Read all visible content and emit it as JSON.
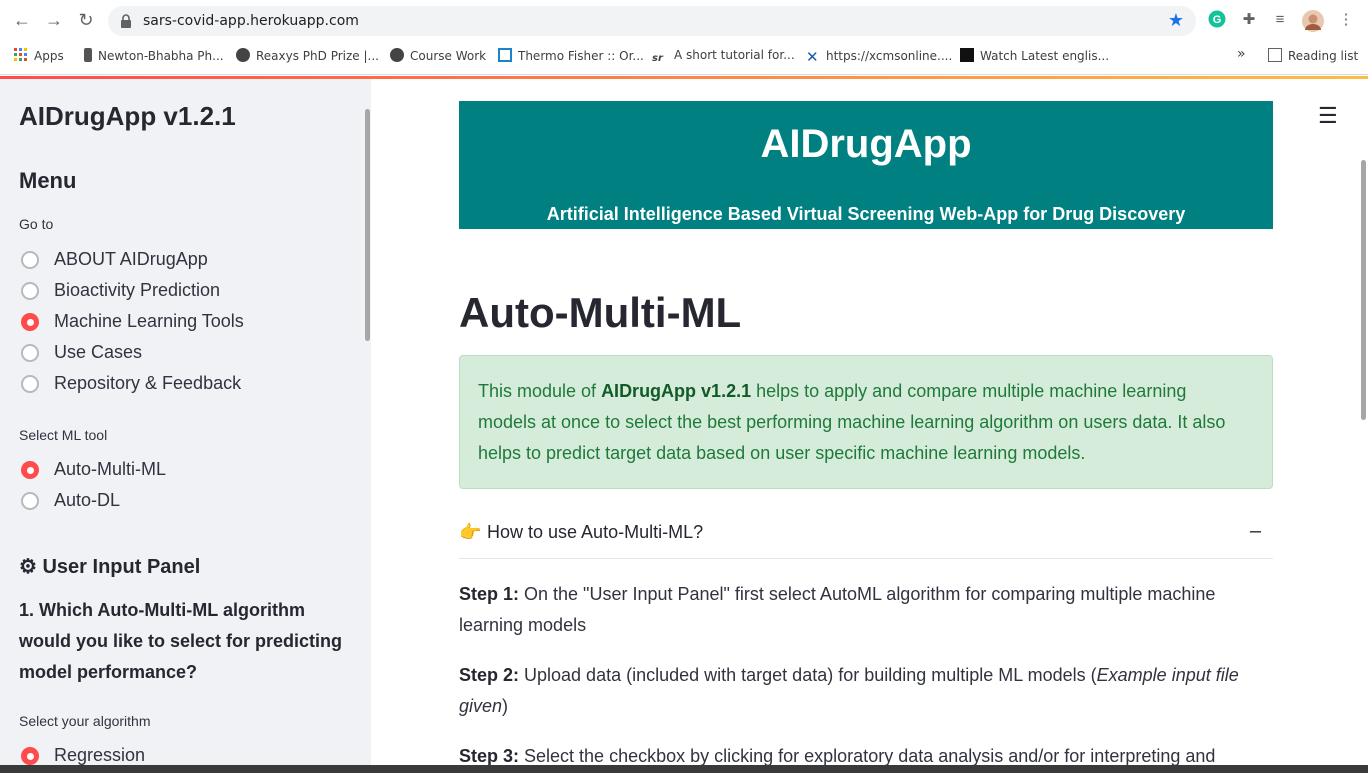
{
  "browser": {
    "url": "sars-covid-app.herokuapp.com",
    "bookmarks": [
      {
        "label": "Apps"
      },
      {
        "label": "Newton-Bhabha Ph..."
      },
      {
        "label": "Reaxys PhD Prize |..."
      },
      {
        "label": "Course Work"
      },
      {
        "label": "Thermo Fisher :: Or..."
      },
      {
        "label": "A short tutorial for..."
      },
      {
        "label": "https://xcmsonline...."
      },
      {
        "label": "Watch Latest englis..."
      }
    ],
    "more_label": "»",
    "reading_list": "Reading list"
  },
  "sidebar": {
    "app_title": "AIDrugApp v1.2.1",
    "menu_heading": "Menu",
    "goto_label": "Go to",
    "goto_options": [
      {
        "label": "ABOUT AIDrugApp",
        "selected": false
      },
      {
        "label": "Bioactivity Prediction",
        "selected": false
      },
      {
        "label": "Machine Learning Tools",
        "selected": true
      },
      {
        "label": "Use Cases",
        "selected": false
      },
      {
        "label": "Repository & Feedback",
        "selected": false
      }
    ],
    "ml_tool_label": "Select ML tool",
    "ml_tool_options": [
      {
        "label": "Auto-Multi-ML",
        "selected": true
      },
      {
        "label": "Auto-DL",
        "selected": false
      }
    ],
    "user_input_panel": "⚙ User Input Panel",
    "question": "1. Which Auto-Multi-ML algorithm would you like to select for predicting model performance?",
    "algorithm_label": "Select your algorithm",
    "algorithm_options": [
      {
        "label": "Regression",
        "selected": true
      }
    ]
  },
  "main": {
    "banner_title": "AIDrugApp",
    "banner_subtitle": "Artificial Intelligence Based Virtual Screening Web-App for Drug Discovery",
    "page_title": "Auto-Multi-ML",
    "info_prefix": "This module of ",
    "info_bold": "AIDrugApp v1.2.1",
    "info_suffix": " helps to apply and compare multiple machine learning models at once to select the best performing machine learning algorithm on users data. It also helps to predict target data based on user specific machine learning models.",
    "expander_label": "How to use Auto-Multi-ML?",
    "expander_toggle": "–",
    "steps": [
      {
        "label": "Step 1:",
        "text": " On the \"User Input Panel\" first select AutoML algorithm for comparing multiple machine learning models"
      },
      {
        "label": "Step 2:",
        "text": " Upload data (included with target data) for building multiple ML models (",
        "italic": "Example input file given",
        "after": ")"
      },
      {
        "label": "Step 3:",
        "text": " Select the checkbox by clicking for exploratory data analysis and/or for interpreting and"
      }
    ]
  }
}
